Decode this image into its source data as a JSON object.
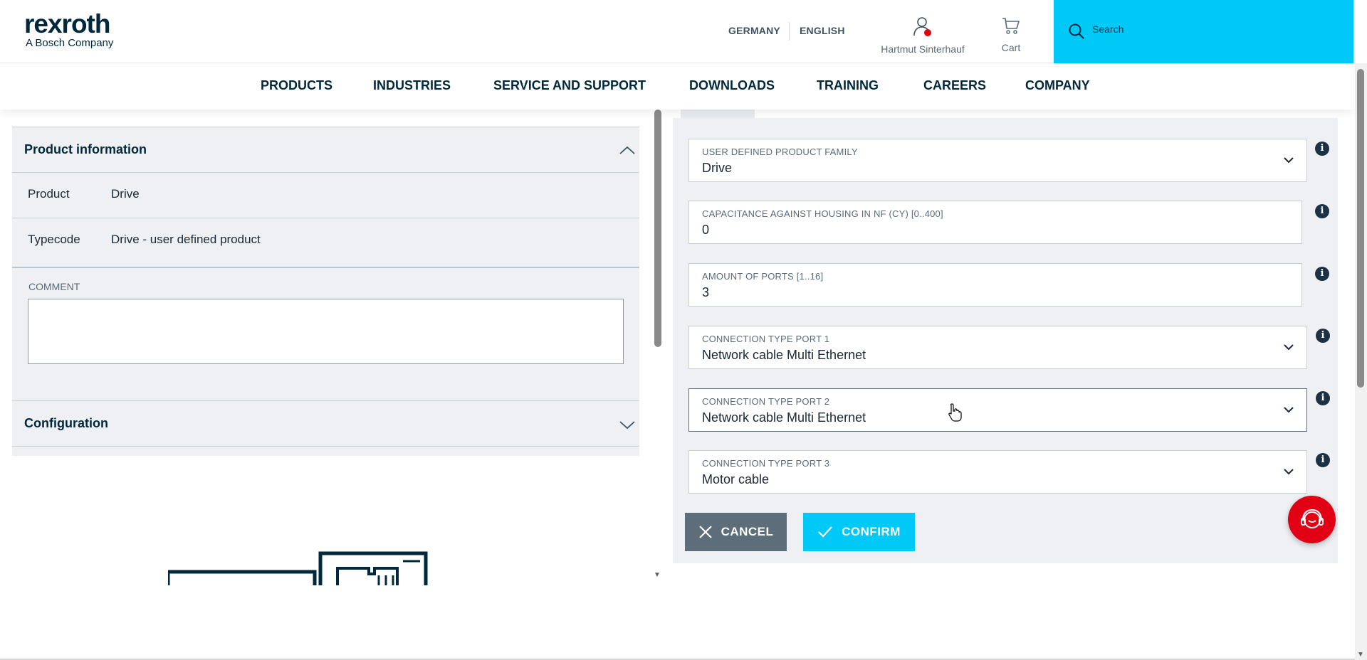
{
  "header": {
    "logo_word": "rexroth",
    "logo_sub": "A Bosch Company",
    "country": "GERMANY",
    "language": "ENGLISH",
    "user_name": "Hartmut Sinterhauf",
    "cart_label": "Cart",
    "search_placeholder": "Search"
  },
  "nav": {
    "items": [
      "PRODUCTS",
      "INDUSTRIES",
      "SERVICE AND SUPPORT",
      "DOWNLOADS",
      "TRAINING",
      "CAREERS",
      "COMPANY"
    ]
  },
  "left": {
    "product_info_title": "Product information",
    "rows": [
      {
        "key": "Product",
        "value": "Drive"
      },
      {
        "key": "Typecode",
        "value": "Drive - user defined product"
      }
    ],
    "comment_label": "COMMENT",
    "comment_value": "",
    "configuration_title": "Configuration"
  },
  "form": {
    "fields": [
      {
        "label": "USER DEFINED PRODUCT FAMILY",
        "value": "Drive",
        "type": "select"
      },
      {
        "label": "CAPACITANCE AGAINST HOUSING IN NF (CY) [0..400]",
        "value": "0",
        "type": "input"
      },
      {
        "label": "AMOUNT OF PORTS [1..16]",
        "value": "3",
        "type": "input"
      },
      {
        "label": "CONNECTION TYPE PORT 1",
        "value": "Network cable Multi Ethernet",
        "type": "select"
      },
      {
        "label": "CONNECTION TYPE PORT 2",
        "value": "Network cable Multi Ethernet",
        "type": "select"
      },
      {
        "label": "CONNECTION TYPE PORT 3",
        "value": "Motor cable",
        "type": "select"
      }
    ],
    "cancel_label": "CANCEL",
    "confirm_label": "CONFIRM"
  },
  "colors": {
    "brand_dark": "#00283c",
    "accent_cyan": "#00c8f7",
    "cancel_gray": "#5d6d79",
    "alert_red": "#e20015",
    "panel_bg": "#eef0f3"
  },
  "icons": [
    "user-icon",
    "cart-icon",
    "search-icon",
    "chevron-up-icon",
    "chevron-down-icon",
    "info-icon",
    "close-icon",
    "check-icon",
    "chat-icon"
  ]
}
